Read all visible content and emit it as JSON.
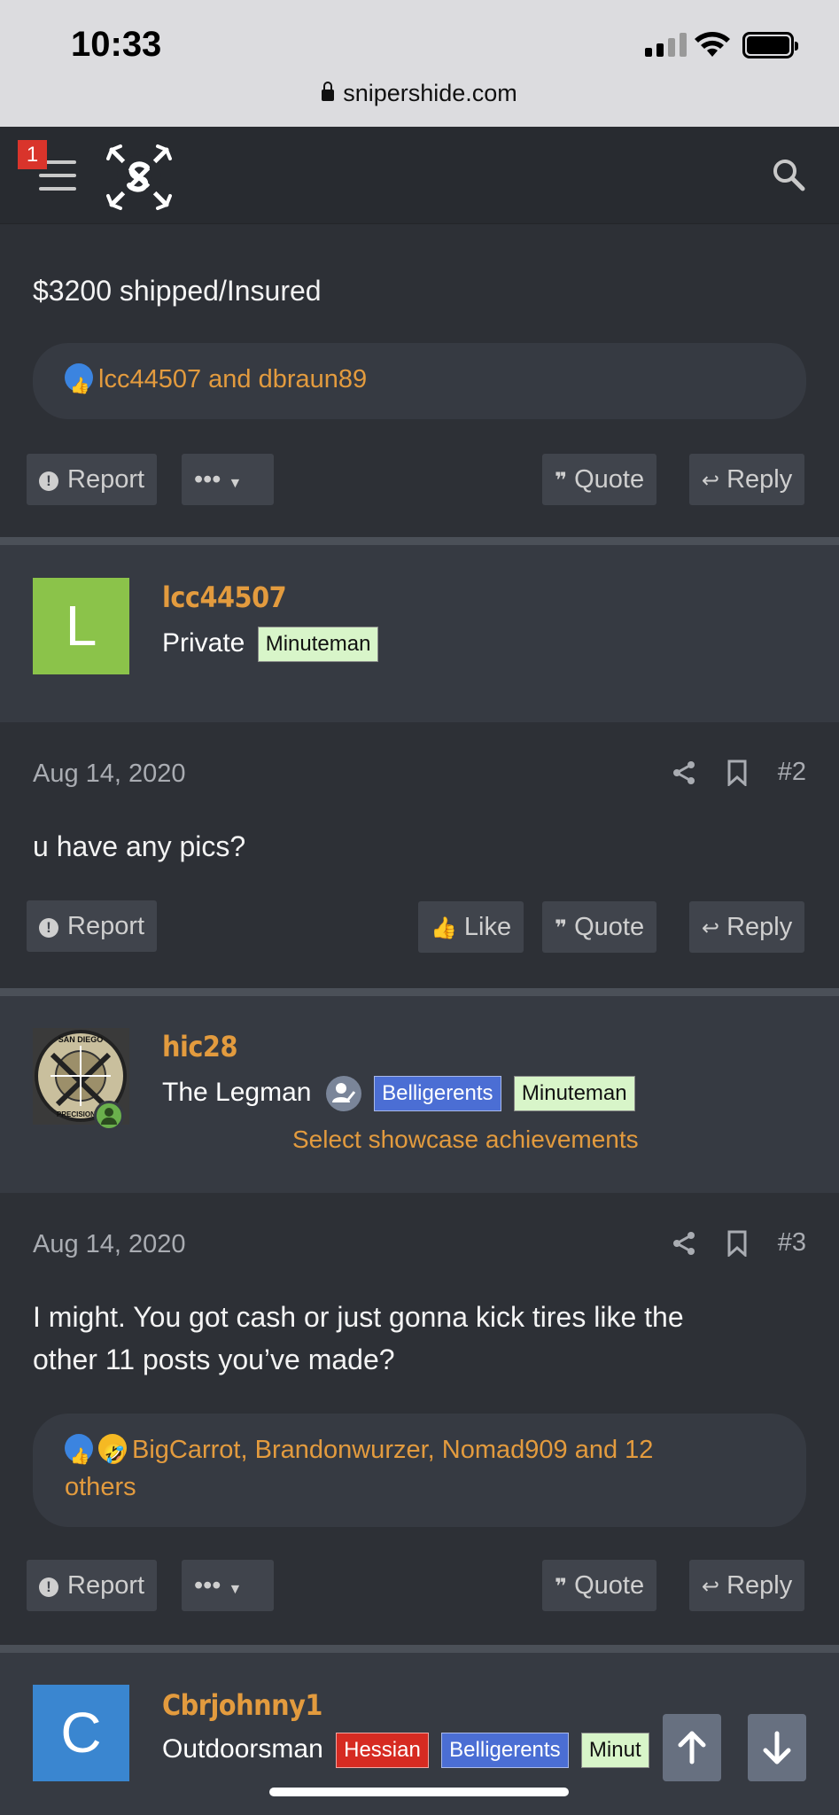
{
  "status_bar": {
    "time": "10:33",
    "url": "snipershide.com"
  },
  "header": {
    "notification_count": "1"
  },
  "post1": {
    "text": "$3200 shipped/Insured",
    "reactions": "lcc44507 and dbraun89",
    "report_label": "Report",
    "more_label": "•••",
    "quote_label": "Quote",
    "reply_label": "Reply"
  },
  "post2": {
    "avatar_letter": "L",
    "avatar_color": "#8bc34a",
    "username": "lcc44507",
    "title": "Private",
    "badges": [
      "Minuteman"
    ],
    "date": "Aug 14, 2020",
    "number": "#2",
    "text": "u have any pics?",
    "report_label": "Report",
    "like_label": "Like",
    "quote_label": "Quote",
    "reply_label": "Reply"
  },
  "post3": {
    "username": "hic28",
    "title": "The Legman",
    "badges": [
      "Belligerents",
      "Minuteman"
    ],
    "showcase_link": "Select showcase achievements",
    "avatar_text_top": "SAN DIEGO",
    "avatar_text_bottom": "PRECISION RI",
    "date": "Aug 14, 2020",
    "number": "#3",
    "text_line1": "I might. You got cash or just gonna kick tires like the",
    "text_line2": "other 11 posts you’ve made?",
    "reactions_line1": "BigCarrot, Brandonwurzer, Nomad909 and 12",
    "reactions_line2": "others",
    "report_label": "Report",
    "more_label": "•••",
    "quote_label": "Quote",
    "reply_label": "Reply"
  },
  "post4": {
    "avatar_letter": "C",
    "avatar_color": "#3a86d0",
    "username": "Cbrjohnny1",
    "title": "Outdoorsman",
    "badges": [
      "Hessian",
      "Belligerents",
      "Minut"
    ]
  },
  "colors": {
    "accent": "#e39b3e",
    "background": "#2d3036",
    "user_bar": "#363a42"
  }
}
